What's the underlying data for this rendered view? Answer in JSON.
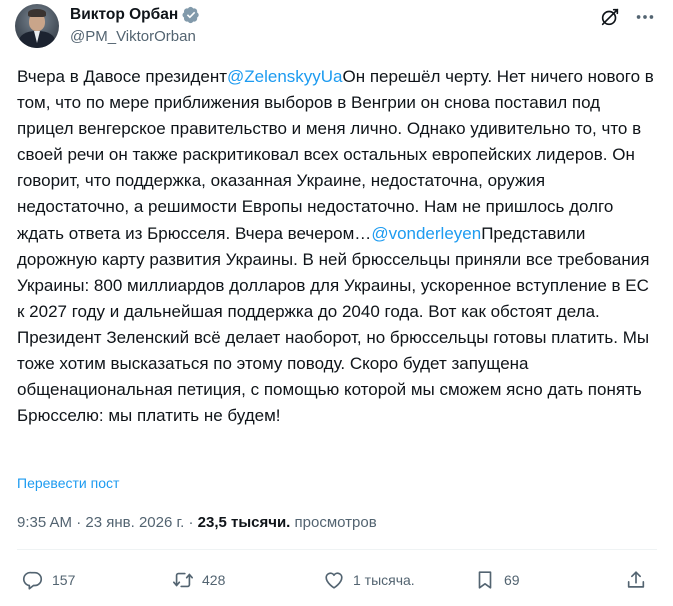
{
  "author": {
    "display_name": "Виктор Орбан",
    "handle": "@PM_ViktorOrban"
  },
  "tweet": {
    "segments": [
      {
        "type": "text",
        "value": "Вчера в Давосе президент"
      },
      {
        "type": "mention",
        "value": "@ZelenskyyUa"
      },
      {
        "type": "text",
        "value": "Он перешёл черту. Нет ничего нового в том, что по мере приближения выборов в Венгрии он снова поставил под прицел венгерское правительство и меня лично. Однако удивительно то, что в своей речи он также раскритиковал всех остальных европейских лидеров. Он говорит, что поддержка, оказанная Украине, недостаточна, оружия недостаточно, а решимости Европы недостаточно. Нам не пришлось долго ждать ответа из Брюсселя. Вчера вечером…"
      },
      {
        "type": "mention",
        "value": "@vonderleyen"
      },
      {
        "type": "text",
        "value": "Представили дорожную карту развития Украины. В ней брюссельцы приняли все требования Украины: 800 миллиардов долларов для Украины, ускоренное вступление в ЕС к 2027 году и дальнейшая поддержка до 2040 года. Вот как обстоят дела. Президент Зеленский всё делает наоборот, но брюссельцы готовы платить. Мы тоже хотим высказаться по этому поводу. Скоро будет запущена общенациональная петиция, с помощью которой мы сможем ясно дать понять Брюсселю: мы платить не будем!"
      }
    ],
    "translate_label": "Перевести пост"
  },
  "meta": {
    "time": "9:35 AM",
    "separator": " · ",
    "date": "23 янв. 2026 г.",
    "views_count": "23,5 тысячи.",
    "views_label": " просмотров"
  },
  "actions": {
    "replies": "157",
    "reposts": "428",
    "likes": "1 тысяча.",
    "bookmarks": "69"
  },
  "colors": {
    "accent": "#1d9bf0",
    "secondary_text": "#536471",
    "primary_text": "#0f1419",
    "verified_badge": "#829aab"
  },
  "icons": {
    "verified": "verified-badge-icon",
    "grok": "grok-icon",
    "more": "more-icon",
    "reply": "reply-icon",
    "repost": "repost-icon",
    "like": "heart-icon",
    "bookmark": "bookmark-icon",
    "share": "share-icon"
  }
}
